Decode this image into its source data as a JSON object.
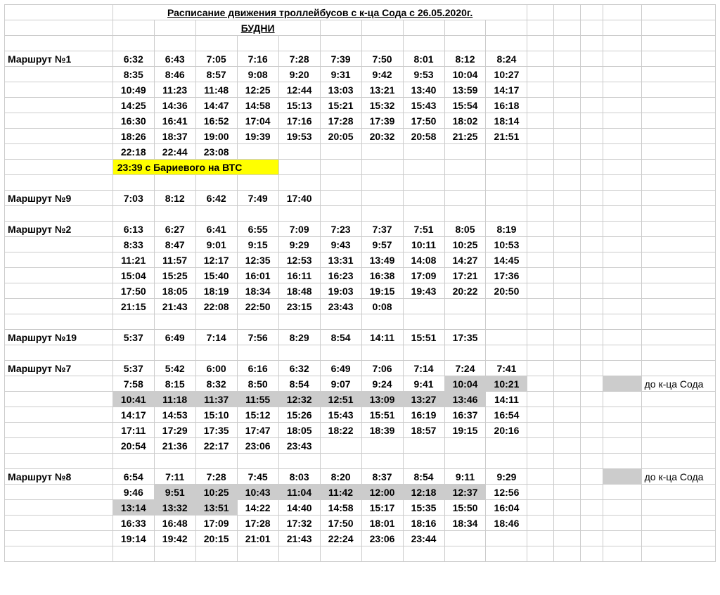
{
  "title": "Расписание движения троллейбусов с к-ца Сода с 26.05.2020г.",
  "subtitle": "БУДНИ",
  "legend_note": "до к-ца Сода",
  "route1": {
    "label": "Маршрут №1",
    "special": "23:39 с Бариевого на ВТС",
    "rows": [
      [
        "6:32",
        "6:43",
        "7:05",
        "7:16",
        "7:28",
        "7:39",
        "7:50",
        "8:01",
        "8:12",
        "8:24"
      ],
      [
        "8:35",
        "8:46",
        "8:57",
        "9:08",
        "9:20",
        "9:31",
        "9:42",
        "9:53",
        "10:04",
        "10:27"
      ],
      [
        "10:49",
        "11:23",
        "11:48",
        "12:25",
        "12:44",
        "13:03",
        "13:21",
        "13:40",
        "13:59",
        "14:17"
      ],
      [
        "14:25",
        "14:36",
        "14:47",
        "14:58",
        "15:13",
        "15:21",
        "15:32",
        "15:43",
        "15:54",
        "16:18"
      ],
      [
        "16:30",
        "16:41",
        "16:52",
        "17:04",
        "17:16",
        "17:28",
        "17:39",
        "17:50",
        "18:02",
        "18:14"
      ],
      [
        "18:26",
        "18:37",
        "19:00",
        "19:39",
        "19:53",
        "20:05",
        "20:32",
        "20:58",
        "21:25",
        "21:51"
      ],
      [
        "22:18",
        "22:44",
        "23:08",
        "",
        "",
        "",
        "",
        "",
        "",
        ""
      ]
    ]
  },
  "route9": {
    "label": "Маршрут №9",
    "rows": [
      [
        "7:03",
        "8:12",
        "6:42",
        "7:49",
        "17:40",
        "",
        "",
        "",
        "",
        ""
      ]
    ]
  },
  "route2": {
    "label": "Маршрут №2",
    "rows": [
      [
        "6:13",
        "6:27",
        "6:41",
        "6:55",
        "7:09",
        "7:23",
        "7:37",
        "7:51",
        "8:05",
        "8:19"
      ],
      [
        "8:33",
        "8:47",
        "9:01",
        "9:15",
        "9:29",
        "9:43",
        "9:57",
        "10:11",
        "10:25",
        "10:53"
      ],
      [
        "11:21",
        "11:57",
        "12:17",
        "12:35",
        "12:53",
        "13:31",
        "13:49",
        "14:08",
        "14:27",
        "14:45"
      ],
      [
        "15:04",
        "15:25",
        "15:40",
        "16:01",
        "16:11",
        "16:23",
        "16:38",
        "17:09",
        "17:21",
        "17:36"
      ],
      [
        "17:50",
        "18:05",
        "18:19",
        "18:34",
        "18:48",
        "19:03",
        "19:15",
        "19:43",
        "20:22",
        "20:50"
      ],
      [
        "21:15",
        "21:43",
        "22:08",
        "22:50",
        "23:15",
        "23:43",
        "0:08",
        "",
        "",
        ""
      ]
    ]
  },
  "route19": {
    "label": "Маршрут №19",
    "rows": [
      [
        "5:37",
        "6:49",
        "7:14",
        "7:56",
        "8:29",
        "8:54",
        "14:11",
        "15:51",
        "17:35",
        ""
      ]
    ]
  },
  "route7": {
    "label": "Маршрут №7",
    "rows": [
      [
        "5:37",
        "5:42",
        "6:00",
        "6:16",
        "6:32",
        "6:49",
        "7:06",
        "7:14",
        "7:24",
        "7:41"
      ],
      [
        "7:58",
        "8:15",
        "8:32",
        "8:50",
        "8:54",
        "9:07",
        "9:24",
        "9:41",
        "10:04",
        "10:21"
      ],
      [
        "10:41",
        "11:18",
        "11:37",
        "11:55",
        "12:32",
        "12:51",
        "13:09",
        "13:27",
        "13:46",
        "14:11"
      ],
      [
        "14:17",
        "14:53",
        "15:10",
        "15:12",
        "15:26",
        "15:43",
        "15:51",
        "16:19",
        "16:37",
        "16:54"
      ],
      [
        "17:11",
        "17:29",
        "17:35",
        "17:47",
        "18:05",
        "18:22",
        "18:39",
        "18:57",
        "19:15",
        "20:16"
      ],
      [
        "20:54",
        "21:36",
        "22:17",
        "23:06",
        "23:43",
        "",
        "",
        "",
        "",
        ""
      ]
    ],
    "gray": {
      "1": [
        8,
        9
      ],
      "2": [
        0,
        1,
        2,
        3,
        4,
        5,
        6,
        7,
        8
      ]
    }
  },
  "route8": {
    "label": "Маршрут №8",
    "rows": [
      [
        "6:54",
        "7:11",
        "7:28",
        "7:45",
        "8:03",
        "8:20",
        "8:37",
        "8:54",
        "9:11",
        "9:29"
      ],
      [
        "9:46",
        "9:51",
        "10:25",
        "10:43",
        "11:04",
        "11:42",
        "12:00",
        "12:18",
        "12:37",
        "12:56"
      ],
      [
        "13:14",
        "13:32",
        "13:51",
        "14:22",
        "14:40",
        "14:58",
        "15:17",
        "15:35",
        "15:50",
        "16:04"
      ],
      [
        "16:33",
        "16:48",
        "17:09",
        "17:28",
        "17:32",
        "17:50",
        "18:01",
        "18:16",
        "18:34",
        "18:46"
      ],
      [
        "19:14",
        "19:42",
        "20:15",
        "21:01",
        "21:43",
        "22:24",
        "23:06",
        "23:44",
        "",
        ""
      ]
    ],
    "gray": {
      "1": [
        1,
        2,
        3,
        4,
        5,
        6,
        7,
        8
      ],
      "2": [
        0,
        1,
        2
      ]
    }
  }
}
